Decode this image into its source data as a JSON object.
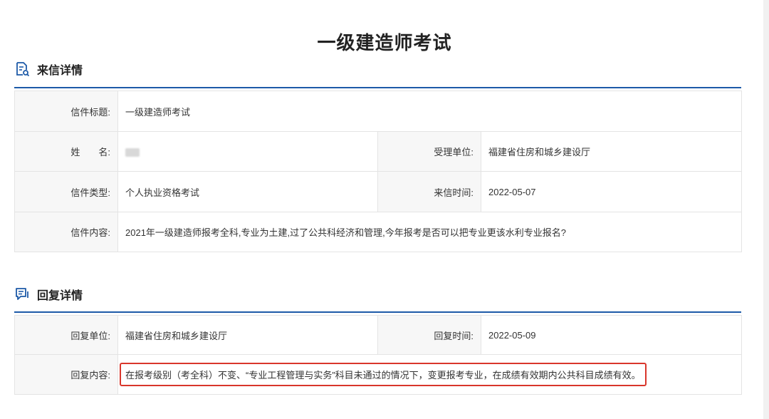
{
  "page": {
    "title": "一级建造师考试"
  },
  "letter_section": {
    "title": "来信详情",
    "icon": "document-search-icon",
    "fields": {
      "subject_label": "信件标题:",
      "subject_value": "一级建造师考试",
      "name_label": "姓　　名:",
      "name_value": "",
      "unit_label": "受理单位:",
      "unit_value": "福建省住房和城乡建设厅",
      "type_label": "信件类型:",
      "type_value": "个人执业资格考试",
      "time_label": "来信时间:",
      "time_value": "2022-05-07",
      "content_label": "信件内容:",
      "content_value": "2021年一级建造师报考全科,专业为土建,过了公共科经济和管理,今年报考是否可以把专业更该水利专业报名?"
    }
  },
  "reply_section": {
    "title": "回复详情",
    "icon": "chat-icon",
    "fields": {
      "unit_label": "回复单位:",
      "unit_value": "福建省住房和城乡建设厅",
      "time_label": "回复时间:",
      "time_value": "2022-05-09",
      "content_label": "回复内容:",
      "content_value": "在报考级别（考全科）不变、“专业工程管理与实务”科目未通过的情况下，变更报考专业，在成绩有效期内公共科目成绩有效。"
    }
  },
  "colors": {
    "accent": "#1d5aa8",
    "highlight_border": "#d9362b",
    "label_bg": "#f7f7f7"
  }
}
